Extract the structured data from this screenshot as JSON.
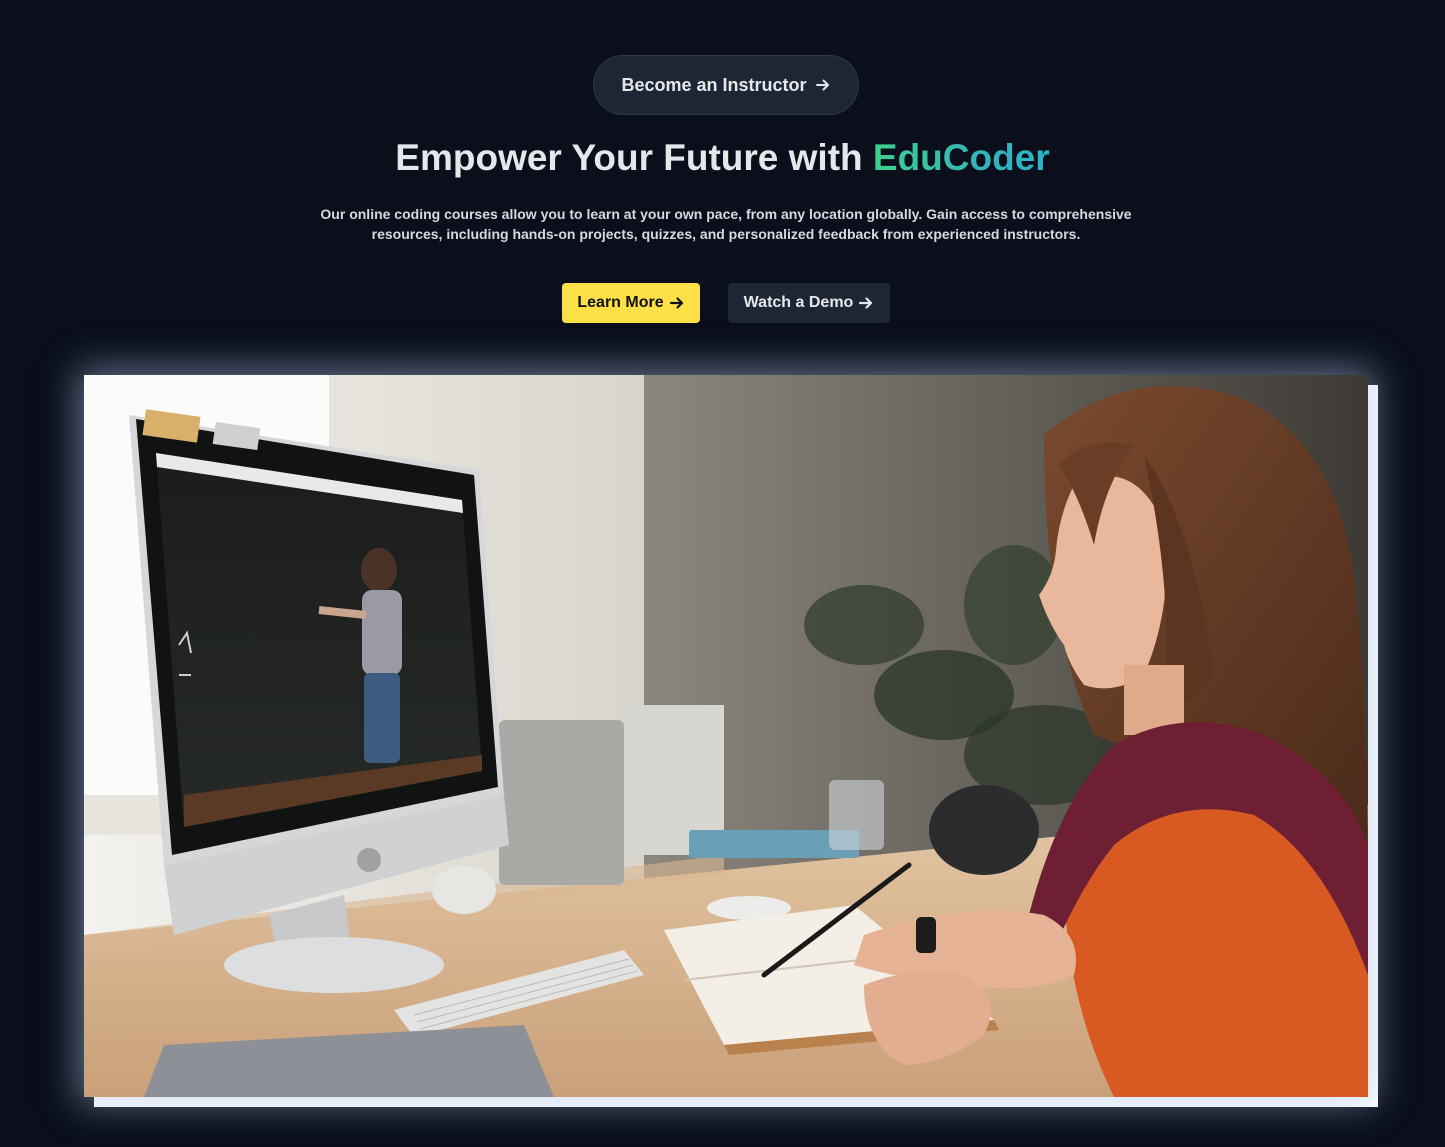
{
  "cta_pill": {
    "label": "Become an Instructor"
  },
  "hero": {
    "title_prefix": "Empower Your Future with ",
    "title_brand": "EduCoder",
    "subtitle": "Our online coding courses allow you to learn at your own pace, from any location globally. Gain access to comprehensive resources, including hands-on projects, quizzes, and personalized feedback from experienced instructors."
  },
  "buttons": {
    "learn_more": "Learn More",
    "watch_demo": "Watch a Demo"
  },
  "icons": {
    "arrow": "arrow-right-icon"
  },
  "colors": {
    "background": "#0a0f1b",
    "accent_yellow": "#fde047",
    "brand_gradient_start": "#3fcf8e",
    "brand_gradient_end": "#2bb3c9",
    "dark_button": "#1e2635"
  }
}
